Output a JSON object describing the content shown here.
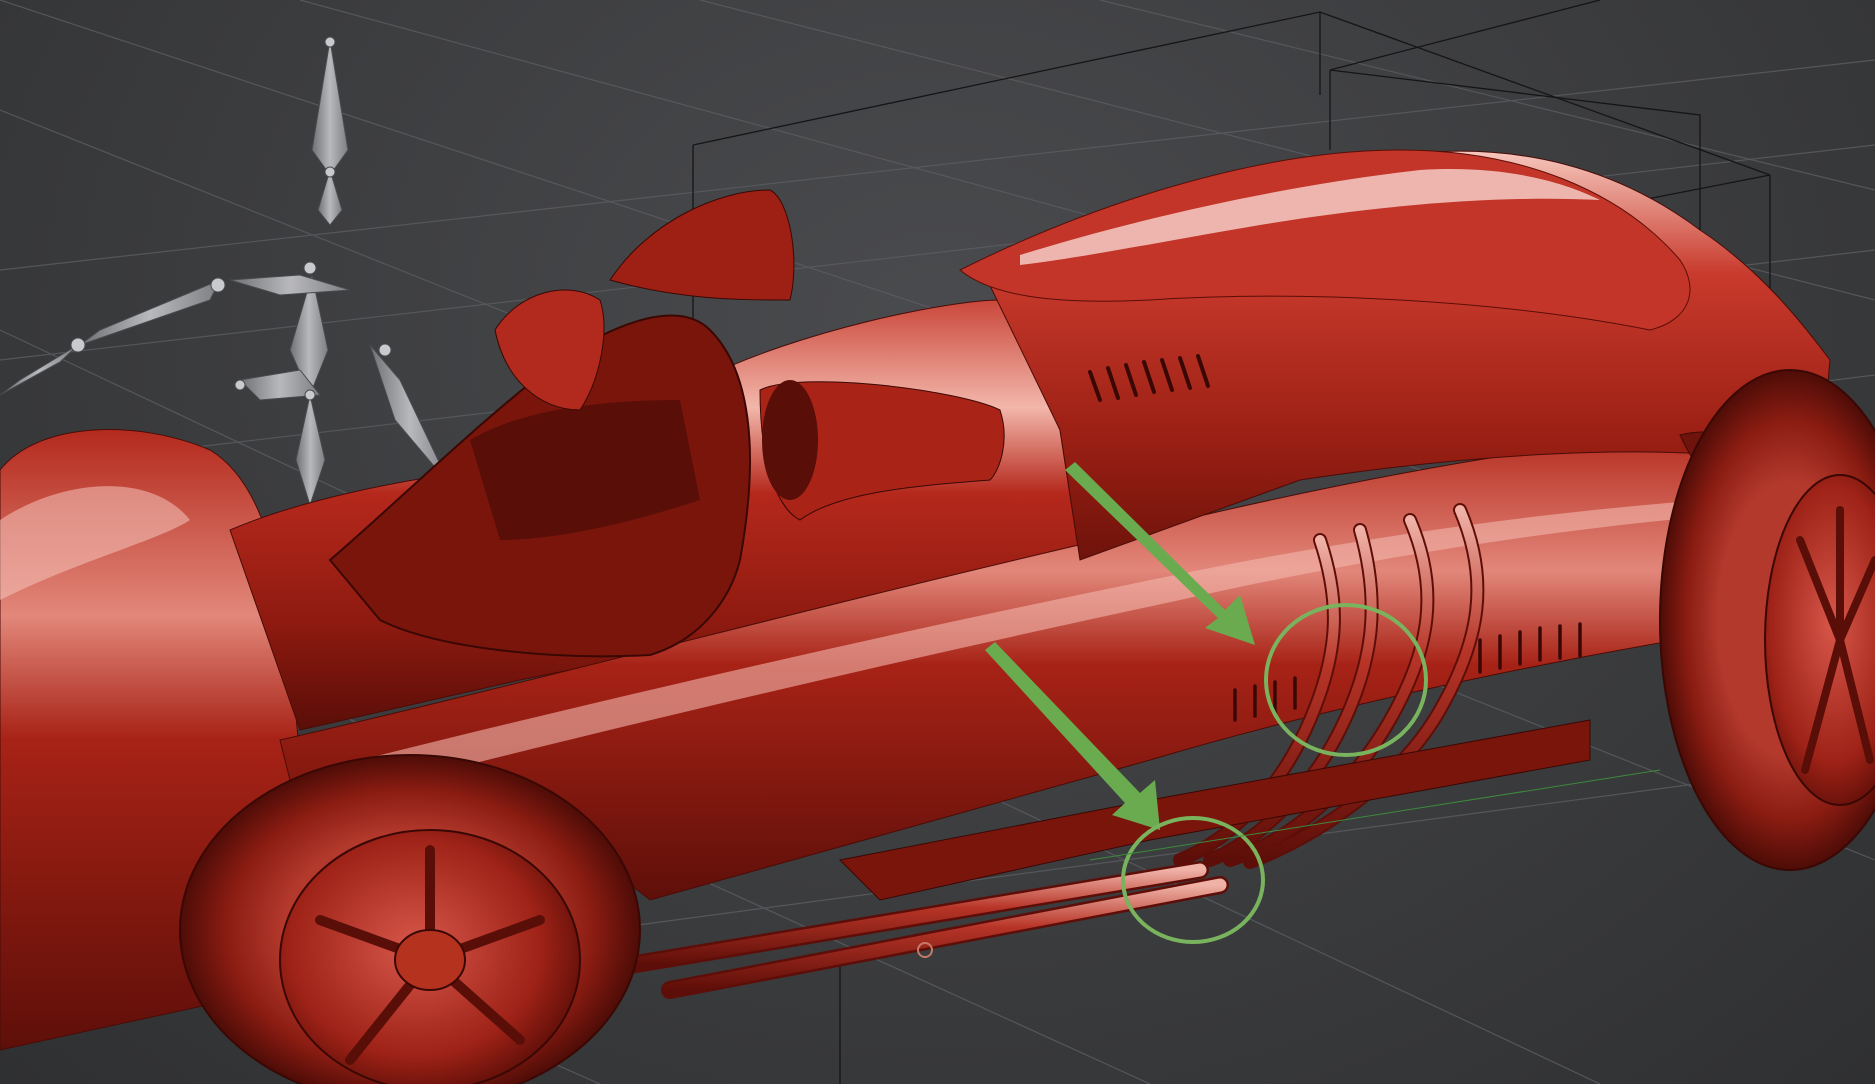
{
  "viewport": {
    "background": "#3c3d3f",
    "grid_color": "#5a5c60",
    "bbox_color": "#111111"
  },
  "model": {
    "body_color": "#a32418",
    "body_highlight": "#f2b3a8",
    "body_shadow": "#4a0c07"
  },
  "skeleton": {
    "color": "#9a9b9e"
  },
  "annotations": {
    "arrow_color": "#6bab4f",
    "circle_color": "#7ab35e"
  }
}
